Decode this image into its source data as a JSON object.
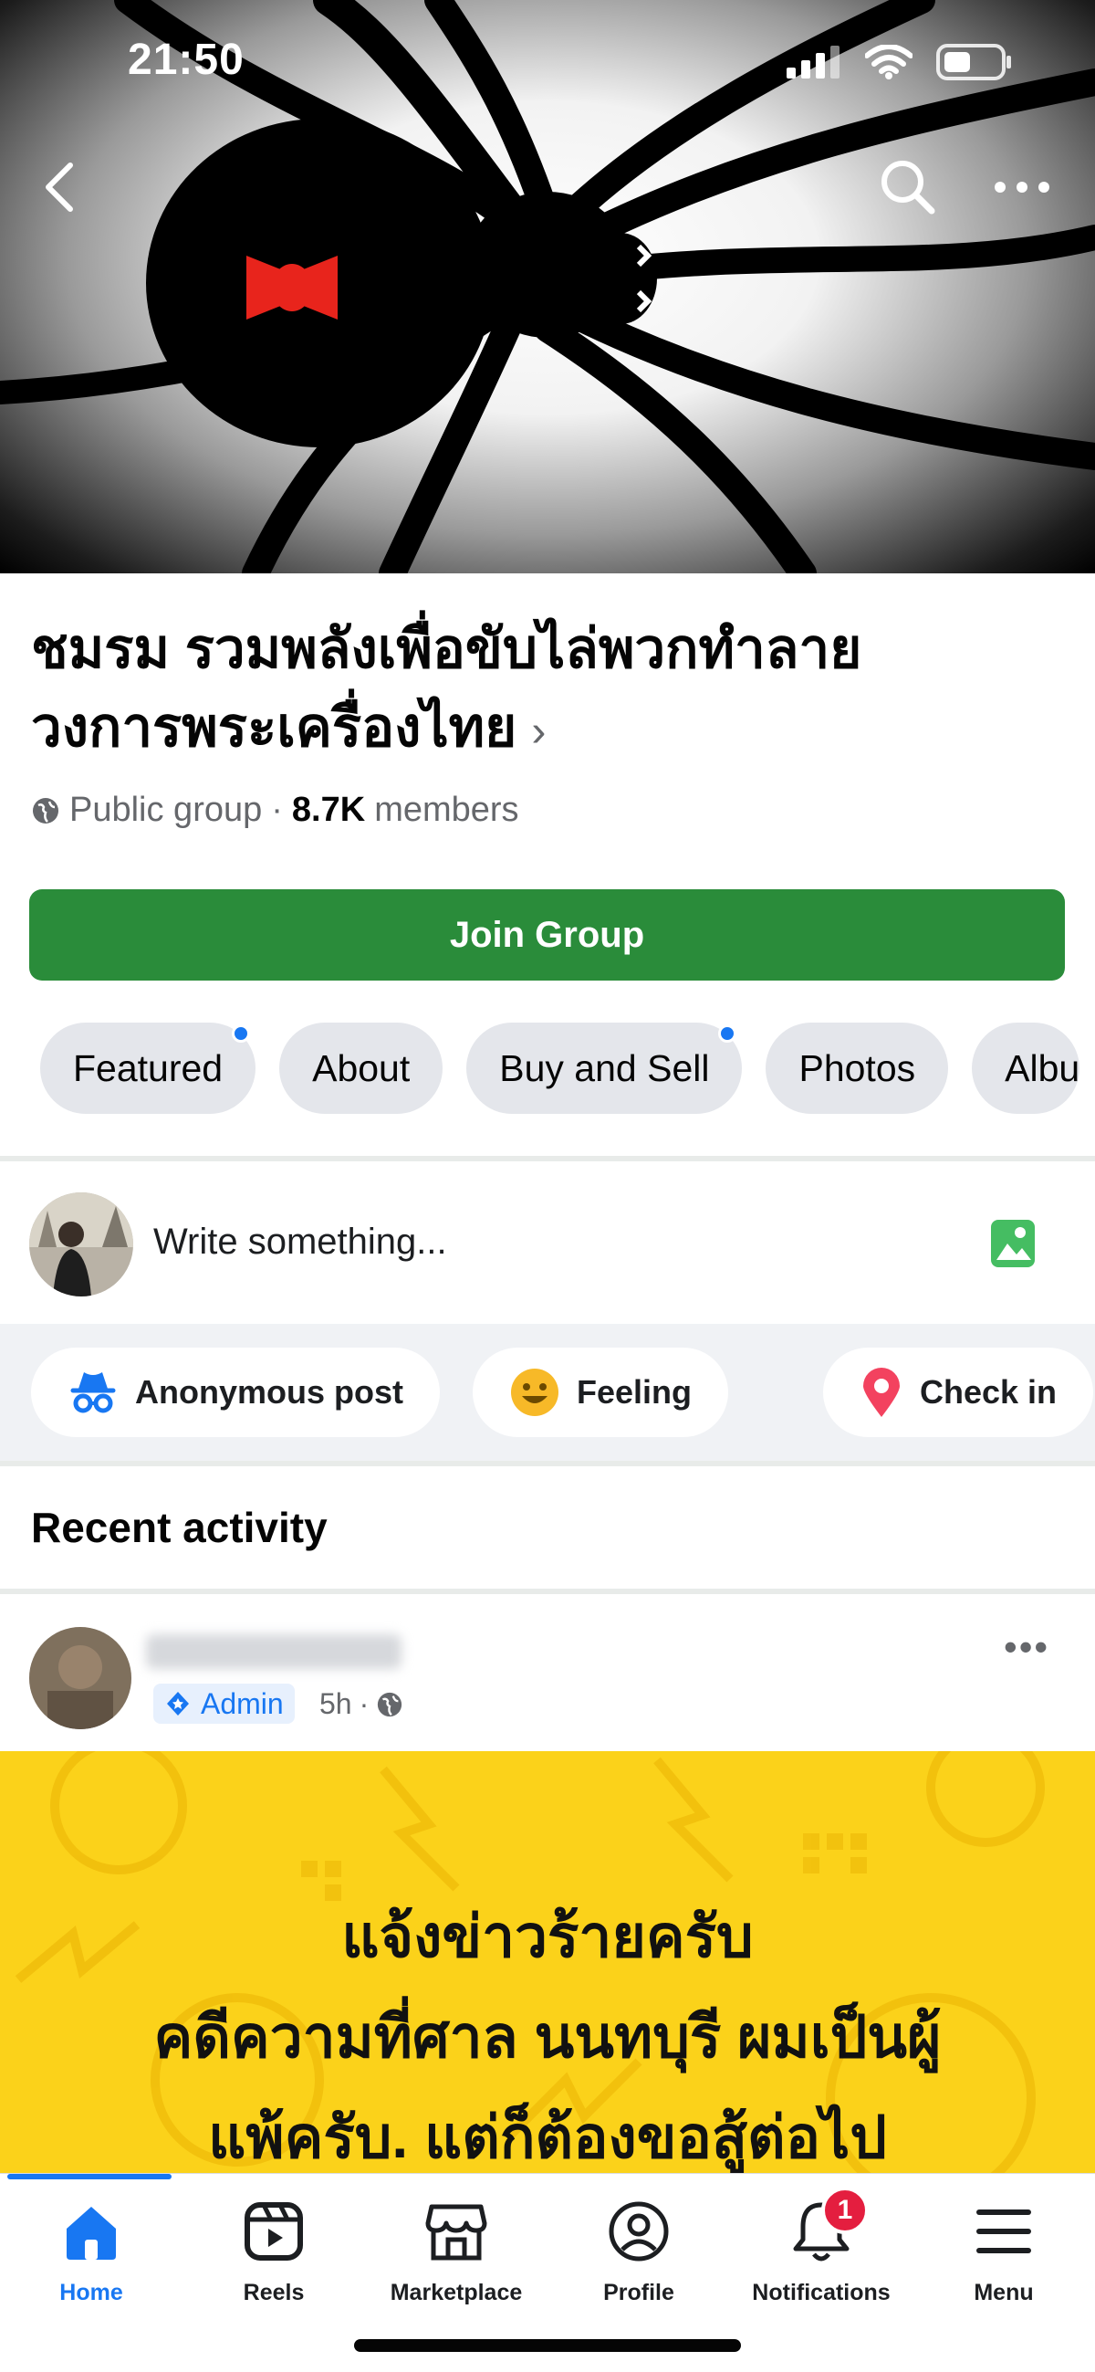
{
  "status": {
    "time": "21:50"
  },
  "group": {
    "title_line1": "ชมรม รวมพลังเพื่อขับไล่พวกทำลาย",
    "title_line2": "วงการพระเครื่องไทย",
    "chevron": "›",
    "privacy": "Public group",
    "separator": "·",
    "member_count": "8.7K",
    "members_label": "members",
    "join_label": "Join Group"
  },
  "tabs": [
    {
      "label": "Featured",
      "has_dot": true
    },
    {
      "label": "About",
      "has_dot": false
    },
    {
      "label": "Buy and Sell",
      "has_dot": true
    },
    {
      "label": "Photos",
      "has_dot": false
    },
    {
      "label": "Albu",
      "has_dot": false
    }
  ],
  "composer": {
    "placeholder": "Write something..."
  },
  "actions": [
    {
      "label": "Anonymous post",
      "icon": "incognito-icon"
    },
    {
      "label": "Feeling",
      "icon": "smiley-icon"
    },
    {
      "label": "Check in",
      "icon": "location-pin-icon"
    }
  ],
  "recent": {
    "title": "Recent activity"
  },
  "post": {
    "badge": "Admin",
    "time": "5h",
    "separator": "·",
    "more": "•••",
    "image_text": [
      "แจ้งข่าวร้ายครับ",
      "คดีความที่ศาล นนทบุรี ผมเป็นผู้",
      "แพ้ครับ. แต่ก็ต้องขอสู้ต่อไป"
    ],
    "image_bg_color": "#fbd21a"
  },
  "nav": {
    "items": [
      {
        "label": "Home",
        "icon": "home-icon",
        "active": true
      },
      {
        "label": "Reels",
        "icon": "reels-icon",
        "active": false
      },
      {
        "label": "Marketplace",
        "icon": "marketplace-icon",
        "active": false
      },
      {
        "label": "Profile",
        "icon": "profile-icon",
        "active": false
      },
      {
        "label": "Notifications",
        "icon": "bell-icon",
        "active": false,
        "badge": "1"
      },
      {
        "label": "Menu",
        "icon": "menu-icon",
        "active": false
      }
    ]
  },
  "colors": {
    "accent": "#1877f2",
    "join_green": "#2a8c3a",
    "badge_red": "#e41e3f"
  }
}
